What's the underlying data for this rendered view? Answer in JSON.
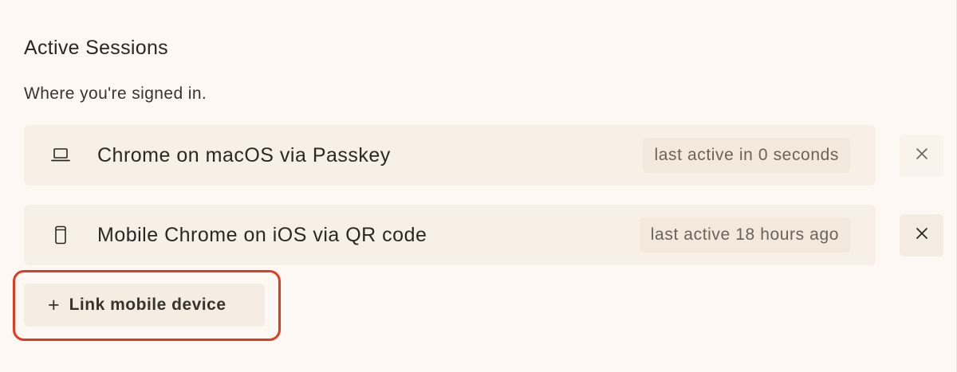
{
  "section": {
    "title": "Active Sessions",
    "subtitle": "Where you're signed in."
  },
  "sessions": [
    {
      "device_icon": "laptop-icon",
      "label": "Chrome on macOS via Passkey",
      "last_active": "last active in 0 seconds",
      "revoke_icon": "close-icon"
    },
    {
      "device_icon": "mobile-phone-icon",
      "label": "Mobile Chrome on iOS via QR code",
      "last_active": "last active 18 hours ago",
      "revoke_icon": "close-icon"
    }
  ],
  "actions": {
    "link_device": {
      "icon": "plus-icon",
      "icon_glyph": "+",
      "label": "Link mobile device"
    }
  },
  "colors": {
    "page_background": "#fdf8f4",
    "row_background": "#f8f0e7",
    "badge_background": "#f2e8dc",
    "text_primary": "#2c2722",
    "text_muted": "#6b6259",
    "highlight_ring": "#e13b1e"
  }
}
